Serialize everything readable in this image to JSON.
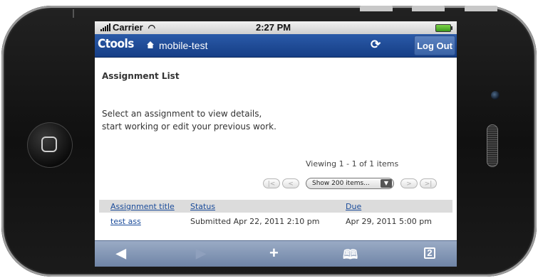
{
  "status_bar": {
    "carrier": "Carrier",
    "time": "2:27 PM"
  },
  "app_bar": {
    "logo": "Ctools",
    "site": "mobile-test",
    "logout": "Log Out"
  },
  "page": {
    "title": "Assignment List",
    "instructions": "Select an assignment to view details, start working or edit your previous work.",
    "viewing": "Viewing 1 - 1 of 1 items",
    "page_size": "Show 200 items..."
  },
  "table": {
    "headers": [
      "Assignment title",
      "Status",
      "Due"
    ],
    "rows": [
      [
        "test ass",
        "Submitted Apr 22, 2011 2:10 pm",
        "Apr 29, 2011 5:00 pm"
      ]
    ]
  },
  "toolbar": {
    "tabs_count": "2"
  },
  "colors": {
    "app_bar": "#1f4c99",
    "link": "#1a4b9a",
    "toolbar": "#7f93b4"
  }
}
